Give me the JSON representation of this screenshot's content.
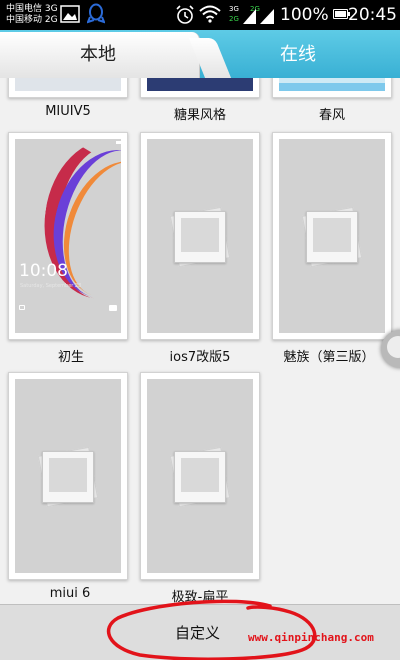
{
  "status_bar": {
    "carrier_1": "中国电信 3G",
    "carrier_2": "中国移动 2G",
    "network_1": "3G",
    "network_2": "2G",
    "network_3": "2G",
    "battery": "100%",
    "time": "20:45",
    "icons": [
      "gallery-icon",
      "qq-icon",
      "alarm-icon",
      "wifi-icon",
      "signal-icon",
      "battery-icon"
    ]
  },
  "tabs": [
    {
      "label": "本地",
      "active": true
    },
    {
      "label": "在线",
      "active": false
    }
  ],
  "themes": [
    {
      "name": "MIUIV5"
    },
    {
      "name": "糖果风格"
    },
    {
      "name": "春风"
    },
    {
      "name": "初生",
      "preview_time": "10:08",
      "preview_date": "Saturday, September 28"
    },
    {
      "name": "ios7改版5"
    },
    {
      "name": "魅族（第三版）"
    },
    {
      "name": "miui 6"
    },
    {
      "name": "极致-扁平"
    }
  ],
  "bottom_button": {
    "label": "自定义"
  },
  "watermark": "www.qinpinchang.com",
  "colors": {
    "tab_bar": "#39b0d4",
    "active_tab": "#ffffff",
    "placeholder": "#d2d2d2",
    "annotation": "#e2131a"
  }
}
